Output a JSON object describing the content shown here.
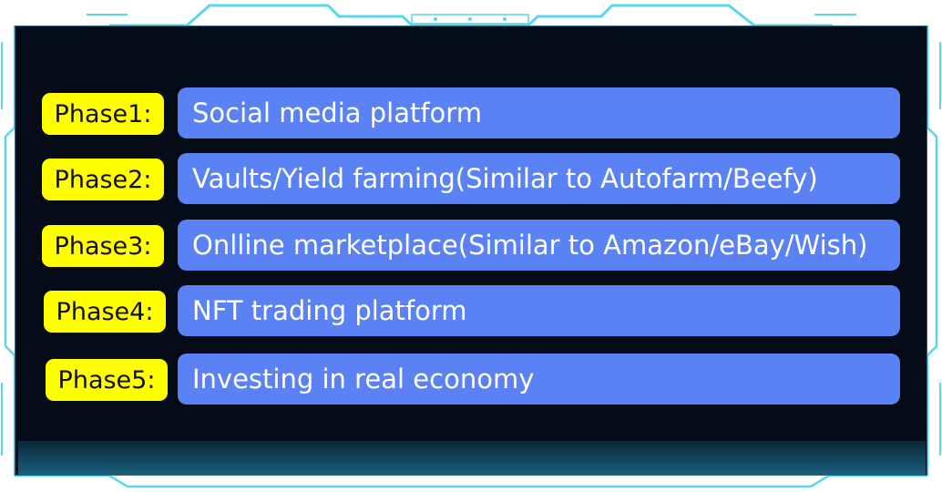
{
  "phases": [
    {
      "label": "Phase1:",
      "text": "Social media platform"
    },
    {
      "label": "Phase2:",
      "text": "Vaults/Yield farming(Similar to Autofarm/Beefy)"
    },
    {
      "label": "Phase3:",
      "text": "Onlline marketplace(Similar to Amazon/eBay/Wish)"
    },
    {
      "label": "Phase4:",
      "text": "NFT trading platform"
    },
    {
      "label": "Phase5:",
      "text": "Investing in real economy"
    }
  ],
  "colors": {
    "background": "#050c18",
    "phase_badge": "#ffff00",
    "bar": "#5b82f5",
    "frame_accent": "#59d6ec"
  }
}
